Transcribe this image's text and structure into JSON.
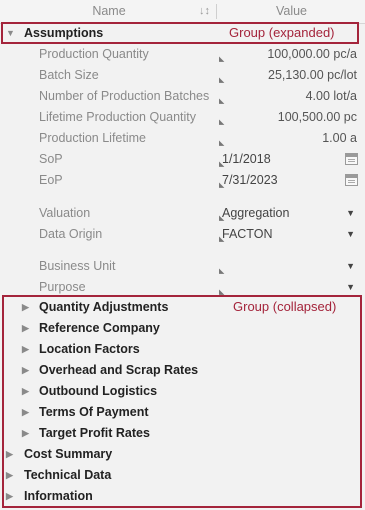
{
  "header": {
    "name_col": "Name",
    "value_col": "Value"
  },
  "annotations": {
    "expanded": "Group (expanded)",
    "collapsed": "Group (collapsed)"
  },
  "assumptions": {
    "label": "Assumptions",
    "rows": [
      {
        "label": "Production Quantity",
        "value": "100,000.00 pc/a"
      },
      {
        "label": "Batch Size",
        "value": "25,130.00 pc/lot"
      },
      {
        "label": "Number of Production Batches",
        "value": "4.00 lot/a"
      },
      {
        "label": "Lifetime Production Quantity",
        "value": "100,500.00 pc"
      },
      {
        "label": "Production Lifetime",
        "value": "1.00 a"
      },
      {
        "label": "SoP",
        "value": "1/1/2018"
      },
      {
        "label": "EoP",
        "value": "7/31/2023"
      },
      {
        "label": "Valuation",
        "value": "Aggregation"
      },
      {
        "label": "Data Origin",
        "value": "FACTON"
      },
      {
        "label": "Business Unit",
        "value": ""
      },
      {
        "label": "Purpose",
        "value": ""
      }
    ]
  },
  "subgroups": [
    "Quantity Adjustments",
    "Reference Company",
    "Location Factors",
    "Overhead and Scrap Rates",
    "Outbound Logistics",
    "Terms Of Payment",
    "Target Profit Rates"
  ],
  "groups": [
    "Cost Summary",
    "Technical Data",
    "Information"
  ]
}
